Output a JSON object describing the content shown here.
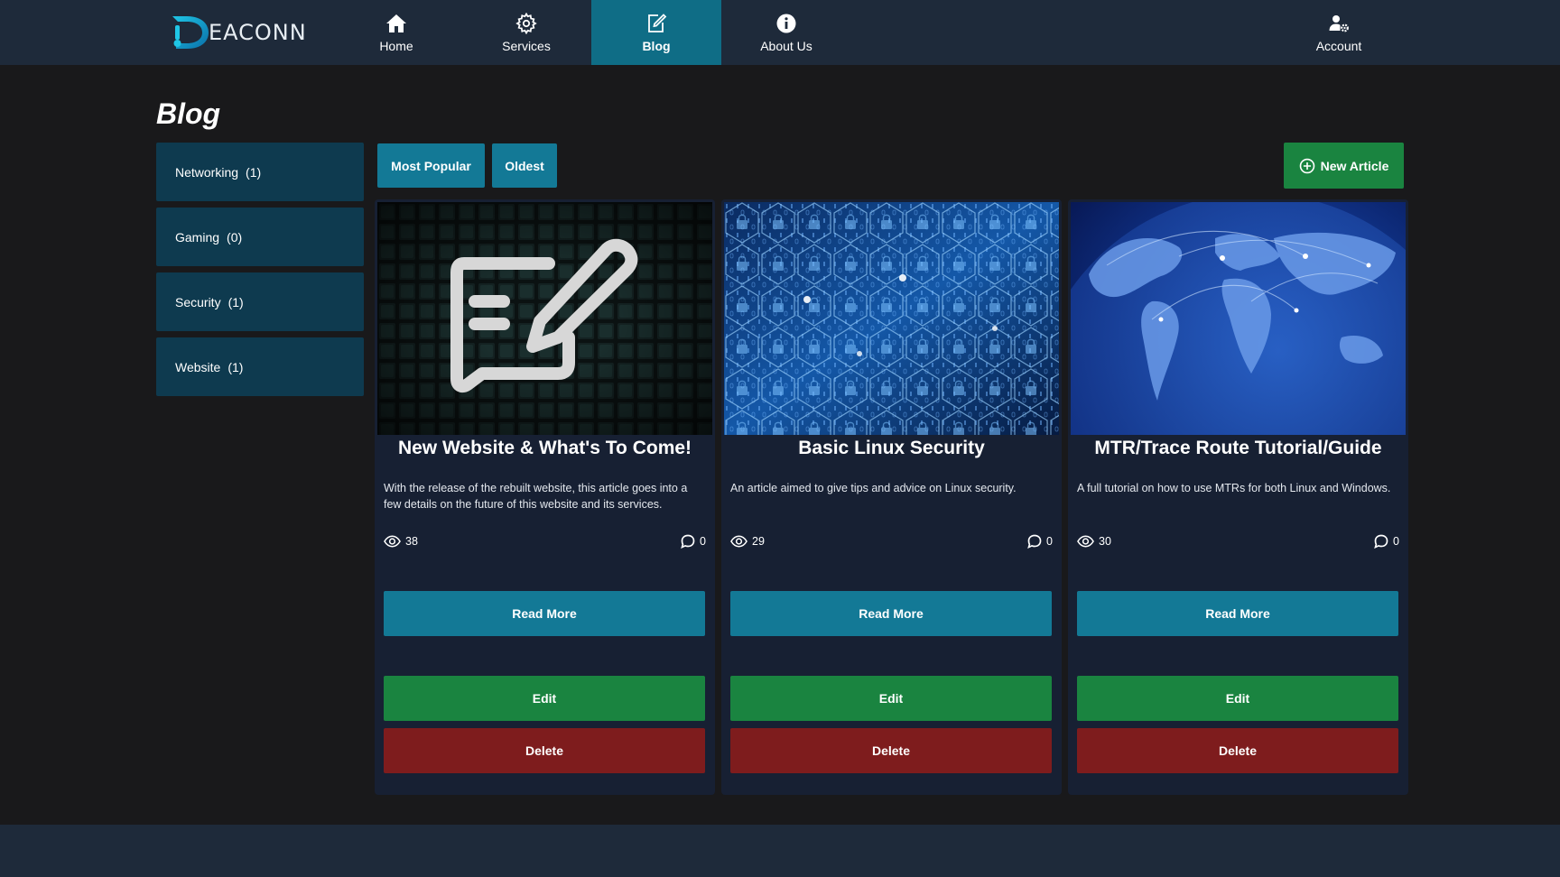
{
  "nav": {
    "brand": "EACONN",
    "items": [
      {
        "label": "Home",
        "icon": "home-icon"
      },
      {
        "label": "Services",
        "icon": "gear-icon"
      },
      {
        "label": "Blog",
        "icon": "edit-icon",
        "active": true
      },
      {
        "label": "About Us",
        "icon": "info-icon"
      },
      {
        "label": "Account",
        "icon": "user-gear-icon"
      }
    ]
  },
  "page": {
    "title": "Blog"
  },
  "categories": [
    {
      "label": "Networking",
      "count": "(1)"
    },
    {
      "label": "Gaming",
      "count": "(0)"
    },
    {
      "label": "Security",
      "count": "(1)"
    },
    {
      "label": "Website",
      "count": "(1)"
    }
  ],
  "filters": {
    "most_popular": "Most Popular",
    "oldest": "Oldest"
  },
  "new_article_label": "New Article",
  "articles": [
    {
      "title": "New Website & What's To Come!",
      "description": "With the release of the rebuilt website, this article goes into a few details on the future of this website and its services.",
      "views": "38",
      "comments": "0",
      "image": "edit-note-icon",
      "read_label": "Read More",
      "edit_label": "Edit",
      "delete_label": "Delete"
    },
    {
      "title": "Basic Linux Security",
      "description": "An article aimed to give tips and advice on Linux security.",
      "views": "29",
      "comments": "0",
      "image": "padlock-network-image",
      "read_label": "Read More",
      "edit_label": "Edit",
      "delete_label": "Delete"
    },
    {
      "title": "MTR/Trace Route Tutorial/Guide",
      "description": "A full tutorial on how to use MTRs for both Linux and Windows.",
      "views": "30",
      "comments": "0",
      "image": "globe-network-image",
      "read_label": "Read More",
      "edit_label": "Edit",
      "delete_label": "Delete"
    }
  ],
  "colors": {
    "nav_bg": "#1e2a3a",
    "accent_teal": "#137996",
    "active_tab": "#0f6d86",
    "success_green": "#1a8440",
    "danger_red": "#7e1c1d",
    "category_bg": "#0e3a4f",
    "card_bg": "#172033"
  }
}
